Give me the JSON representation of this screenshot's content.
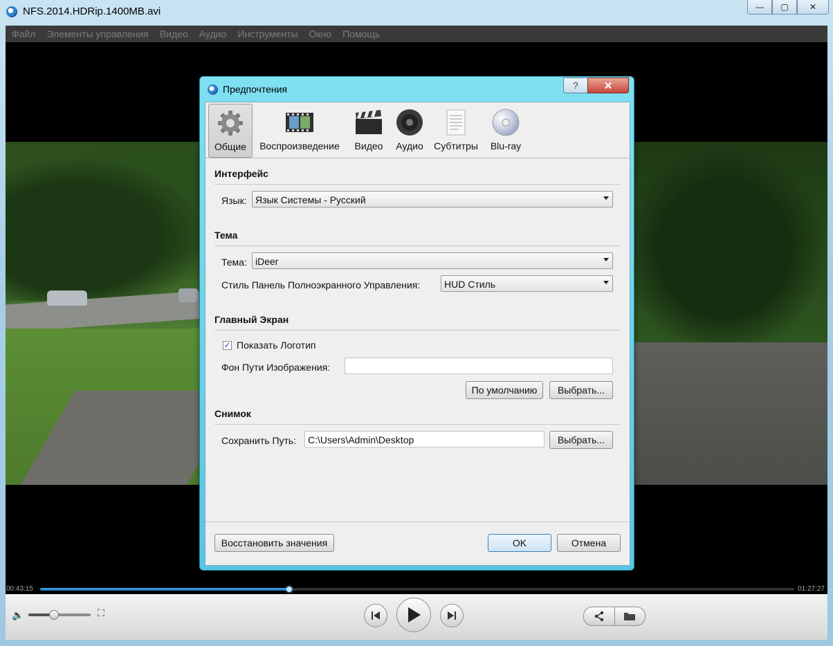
{
  "window": {
    "title": "NFS.2014.HDRip.1400MB.avi",
    "caption_minimize": "—",
    "caption_maximize": "▢",
    "caption_close": "✕"
  },
  "menu": [
    "Файл",
    "Элементы управления",
    "Видео",
    "Аудио",
    "Инструменты",
    "Окно",
    "Помощь"
  ],
  "player": {
    "time_elapsed": "00:43:15",
    "time_total": "01:27:27",
    "progress": 0.33,
    "volume": 0.4
  },
  "dialog": {
    "title": "Предпочтения",
    "help_label": "?",
    "close_label": "✕",
    "tabs": [
      {
        "label": "Общие",
        "icon": "gear-icon"
      },
      {
        "label": "Воспроизведение",
        "icon": "film-strip-icon"
      },
      {
        "label": "Видео",
        "icon": "clapperboard-icon"
      },
      {
        "label": "Аудио",
        "icon": "speaker-icon"
      },
      {
        "label": "Субтитры",
        "icon": "document-icon"
      },
      {
        "label": "Blu-ray",
        "icon": "disc-icon"
      }
    ],
    "interface": {
      "heading": "Интерфейс",
      "language_label": "Язык:",
      "language_value": "Язык Системы - Русский"
    },
    "theme": {
      "heading": "Тема",
      "theme_label": "Тема:",
      "theme_value": "iDeer",
      "hud_label": "Стиль Панель Полноэкранного Управления:",
      "hud_value": "HUD Стиль"
    },
    "main_screen": {
      "heading": "Главный Экран",
      "show_logo_label": "Показать Логотип",
      "show_logo_checked": true,
      "bg_path_label": "Фон Пути Изображения:",
      "bg_path_value": "",
      "default_button": "По умолчанию",
      "browse_button": "Выбрать..."
    },
    "snapshot": {
      "heading": "Снимок",
      "save_path_label": "Сохранить Путь:",
      "save_path_value": "C:\\Users\\Admin\\Desktop",
      "browse_button": "Выбрать..."
    },
    "restore_button": "Восстановить значения",
    "ok_button": "OK",
    "cancel_button": "Отмена"
  },
  "colors": {
    "dialog_frame": "#7fe0f2",
    "seek_fill": "#3aa6e6",
    "close_button": "#c8473a"
  }
}
